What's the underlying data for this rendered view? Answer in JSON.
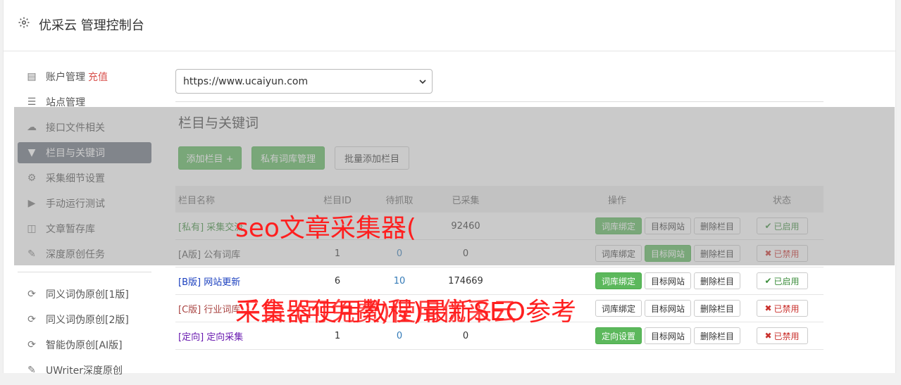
{
  "header": {
    "title": "优采云 管理控制台"
  },
  "sidebar": {
    "items": [
      {
        "label": "账户管理",
        "extra": "充值",
        "icon": "bar-chart-icon"
      },
      {
        "label": "站点管理",
        "icon": "server-icon"
      },
      {
        "label": "接口文件相关",
        "icon": "cloud-upload-icon"
      },
      {
        "label": "栏目与关键词",
        "icon": "filter-icon",
        "active": true
      },
      {
        "label": "采集细节设置",
        "icon": "cogs-icon"
      },
      {
        "label": "手动运行测试",
        "icon": "play-icon"
      },
      {
        "label": "文章暂存库",
        "icon": "database-icon"
      },
      {
        "label": "深度原创任务",
        "icon": "edit-icon"
      }
    ],
    "items2": [
      {
        "label": "同义词伪原创[1版]",
        "icon": "refresh-icon"
      },
      {
        "label": "同义词伪原创[2版]",
        "icon": "refresh-icon"
      },
      {
        "label": "智能伪原创[AI版]",
        "icon": "refresh-icon"
      },
      {
        "label": "UWriter深度原创",
        "icon": "edit-icon"
      }
    ]
  },
  "main": {
    "site_select": "https://www.ucaiyun.com",
    "section_title": "栏目与关键词",
    "add_column": "添加栏目 +",
    "private_lib": "私有词库管理",
    "batch_add": "批量添加栏目",
    "headers": [
      "栏目名称",
      "栏目ID",
      "待抓取",
      "已采集",
      "操作",
      "状态"
    ],
    "rows": [
      {
        "tag": "[私有]",
        "name": "采集交流",
        "id": "",
        "wait": "",
        "done": "92460",
        "op1": "词库绑定",
        "op1_green": true,
        "op2": "目标网站",
        "op2_green": false,
        "op3": "删除栏目",
        "status": "已启用",
        "on": true,
        "color": "#3c8d3c"
      },
      {
        "tag": "[A版]",
        "name": "公有词库",
        "id": "1",
        "wait": "0",
        "done": "0",
        "op1": "词库绑定",
        "op1_green": false,
        "op2": "目标网站",
        "op2_green": true,
        "op3": "删除栏目",
        "status": "已禁用",
        "on": false,
        "color": "#555555"
      },
      {
        "tag": "[B版]",
        "name": "网站更新",
        "id": "6",
        "wait": "10",
        "done": "174669",
        "op1": "词库绑定",
        "op1_green": true,
        "op2": "目标网站",
        "op2_green": false,
        "op3": "删除栏目",
        "status": "已启用",
        "on": true,
        "color": "#1a3fbf"
      },
      {
        "tag": "[C版]",
        "name": "行业词库",
        "id": "",
        "wait": "",
        "done": "",
        "op1": "词库绑定",
        "op1_green": false,
        "op2": "目标网站",
        "op2_green": false,
        "op3": "删除栏目",
        "status": "已禁用",
        "on": false,
        "color": "#a94442"
      },
      {
        "tag": "[定向]",
        "name": "定向采集",
        "id": "1",
        "wait": "0",
        "done": "0",
        "op1": "定向设置",
        "op1_green": true,
        "op2": "目标网站",
        "op2_green": false,
        "op3": "删除栏目",
        "status": "已禁用",
        "on": false,
        "color": "#6a1bb0"
      }
    ]
  },
  "watermarks": {
    "line1": "seo文章采集器(",
    "line2": "采集器使用教程)最新SEO参考",
    "line3": "平台:(可免费)使用优采云"
  }
}
